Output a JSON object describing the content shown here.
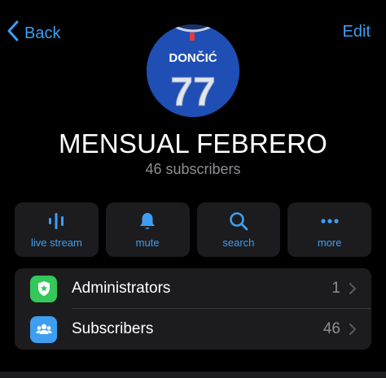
{
  "nav": {
    "back_label": "Back",
    "edit_label": "Edit",
    "back_icon": "chevron-left-icon"
  },
  "channel": {
    "title": "MENSUAL FEBRERO",
    "subscribers_text": "46 subscribers",
    "avatar_jersey_name": "DONČIĆ",
    "avatar_jersey_number": "77"
  },
  "actions": [
    {
      "label": "live stream",
      "icon": "live-stream-icon"
    },
    {
      "label": "mute",
      "icon": "bell-icon"
    },
    {
      "label": "search",
      "icon": "search-icon"
    },
    {
      "label": "more",
      "icon": "more-dots-icon"
    }
  ],
  "list": [
    {
      "label": "Administrators",
      "count": "1",
      "icon": "admin-shield-icon",
      "color": "#34c759"
    },
    {
      "label": "Subscribers",
      "count": "46",
      "icon": "subscribers-group-icon",
      "color": "#3e9ef2"
    }
  ],
  "colors": {
    "accent": "#3e9ef2",
    "background": "#000000",
    "card": "#1c1c1e",
    "secondary_text": "#8e8e93"
  }
}
